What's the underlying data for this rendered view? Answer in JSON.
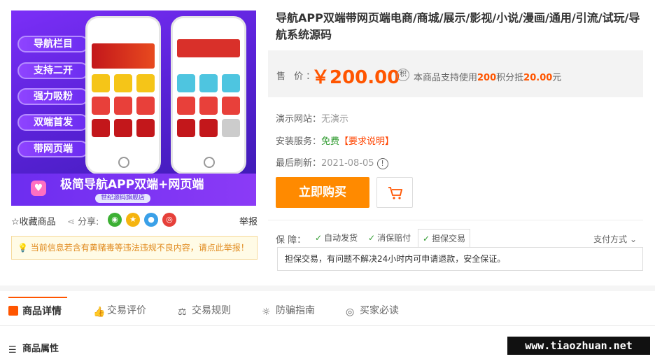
{
  "hero": {
    "pills": [
      "导航栏目",
      "支持二开",
      "强力吸粉",
      "双端首发",
      "带网页端"
    ],
    "bottom_title": "极简导航APP双端+网页端",
    "bottom_sub": "世纪源码旗舰店"
  },
  "actions": {
    "favorite": "☆收藏商品",
    "share": "分享:",
    "report": "举报",
    "social_icons": [
      "wechat-icon",
      "qzone-icon",
      "qq-icon",
      "weibo-icon"
    ]
  },
  "warning": "当前信息若含有黄赌毒等违法违规不良内容，请点此举报！",
  "product": {
    "title": "导航APP双端带网页端电商/商城/展示/影视/小说/漫画/通用/引流/试玩/导航系统源码",
    "price_label": "售 价：",
    "price": "￥200.00",
    "points_prefix": "本商品支持使用",
    "points": "200",
    "points_mid": "积分抵",
    "points_value": "20.00",
    "points_suffix": "元"
  },
  "info": {
    "demo_label": "演示网站：",
    "demo_value": "无演示",
    "install_label": "安装服务：",
    "install_free": "免费",
    "install_req": "【要求说明】",
    "refresh_label": "最后刷新：",
    "refresh_value": "2021-08-05"
  },
  "buy_label": "立即购买",
  "guarantee": {
    "label": "保  障：",
    "tabs": [
      "自动发货",
      "消保赔付",
      "担保交易"
    ],
    "pay_method": "支付方式",
    "description": "担保交易，有问题不解决24小时内可申请退款，安全保证。"
  },
  "tabs": [
    "商品详情",
    "交易评价",
    "交易规则",
    "防骗指南",
    "买家必读"
  ],
  "attributes_title": "商品属性",
  "watermark": "www.tiaozhuan.net",
  "colors": {
    "accent": "#ff5500",
    "buy": "#ff8a00",
    "hero": "#5a22d8"
  }
}
